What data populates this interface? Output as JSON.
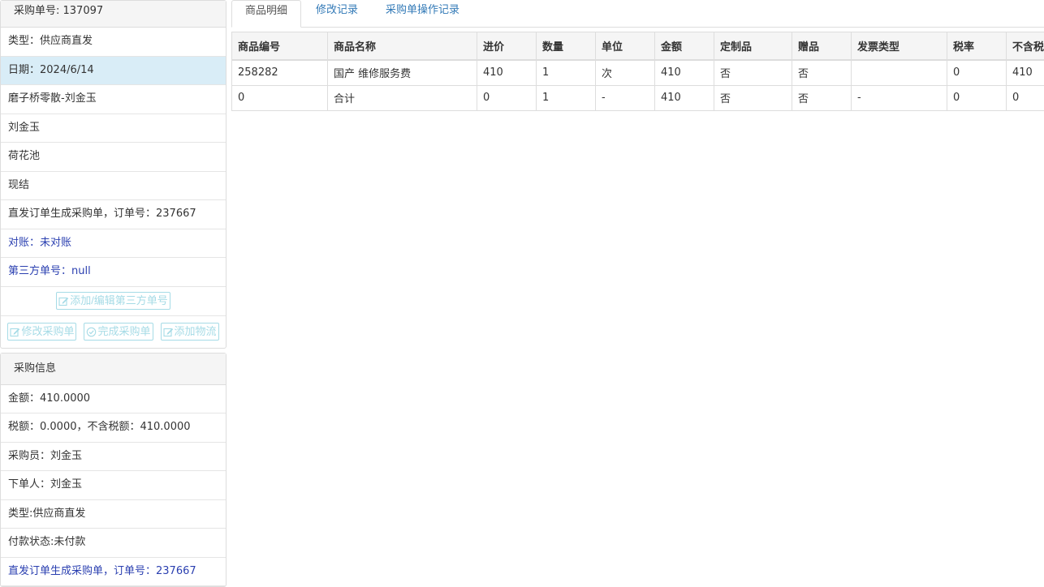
{
  "order_panel": {
    "header": "采购单号: 137097",
    "rows": [
      "类型：供应商直发",
      "日期：2024/6/14",
      "磨子桥零散-刘金玉",
      "刘金玉",
      "荷花池",
      "现结",
      "直发订单生成采购单，订单号：237667",
      "对账：未对账",
      "第三方单号：null"
    ],
    "buttons": {
      "third_party": "添加/编辑第三方单号",
      "edit": "修改采购单",
      "complete": "完成采购单",
      "logistics": "添加物流"
    }
  },
  "purchase_panel": {
    "header": "采购信息",
    "rows": [
      "金额：410.0000",
      "税额：0.0000，不含税额：410.0000",
      "采购员：刘金玉",
      "下单人：刘金玉",
      "类型:供应商直发",
      "付款状态:未付款",
      "直发订单生成采购单，订单号：237667"
    ]
  },
  "tabs": [
    "商品明细",
    "修改记录",
    "采购单操作记录"
  ],
  "table": {
    "headers": [
      "商品编号",
      "商品名称",
      "进价",
      "数量",
      "单位",
      "金额",
      "定制品",
      "赠品",
      "发票类型",
      "税率",
      "不含税"
    ],
    "rows": [
      [
        "258282",
        "国产 维修服务费",
        "410",
        "1",
        "次",
        "410",
        "否",
        "否",
        "",
        "0",
        "410"
      ],
      [
        "0",
        "合计",
        "0",
        "1",
        "-",
        "410",
        "否",
        "否",
        "-",
        "0",
        "0"
      ]
    ]
  },
  "colors": {
    "active_row": "#d9edf7",
    "link_blue": "#337ab7",
    "note_blue": "#2a3fb0",
    "disabled_btn": "#a6dbe6"
  }
}
